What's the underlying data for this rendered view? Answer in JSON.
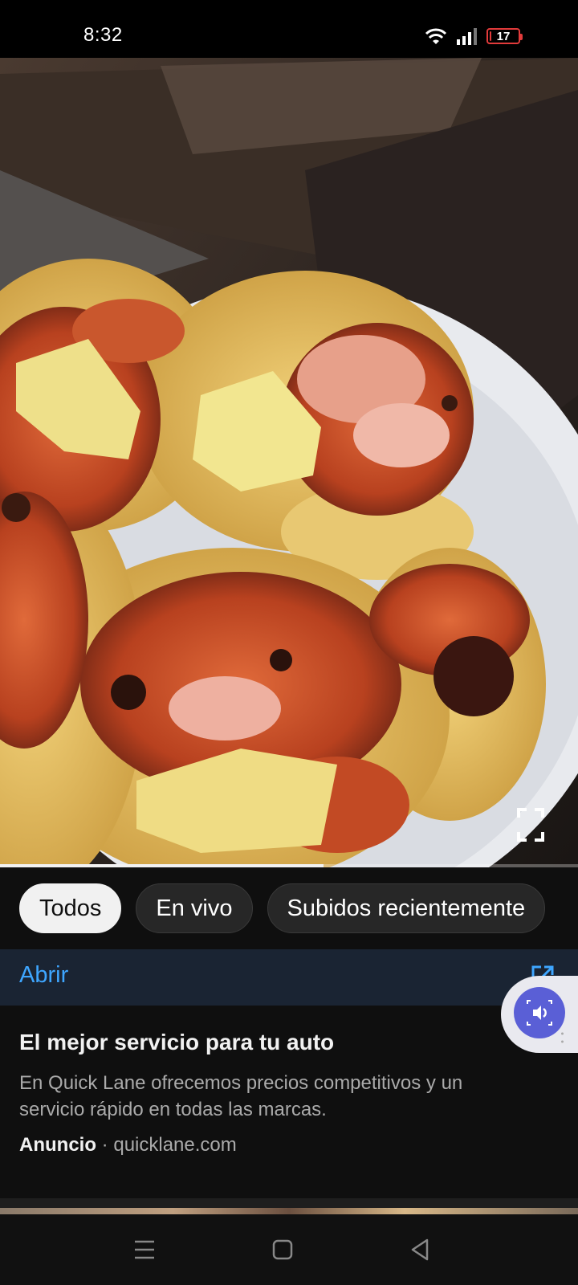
{
  "status_bar": {
    "time": "8:32",
    "battery_level": "17",
    "battery_fraction": 0.17,
    "battery_color": "#e23b3b"
  },
  "video": {
    "progress_fraction": 0.56,
    "icons": {
      "fullscreen": "fullscreen-icon"
    }
  },
  "chips": [
    {
      "label": "Todos",
      "selected": true
    },
    {
      "label": "En vivo",
      "selected": false
    },
    {
      "label": "Subidos recientemente",
      "selected": false
    }
  ],
  "ad": {
    "open_label": "Abrir",
    "open_icon": "external-link-icon",
    "title": "El mejor servicio para tu auto",
    "description": "En Quick Lane ofrecemos precios competitivos y un servicio rápido en todas las marcas.",
    "badge": "Anuncio",
    "separator": "·",
    "domain": "quicklane.com",
    "accent_color": "#3ea6ff"
  },
  "floating_bubble": {
    "icon": "volume-icon",
    "color": "#5a5fd6"
  },
  "nav_bar": {
    "menu_icon": "menu-icon",
    "home_icon": "home-square-icon",
    "back_icon": "back-triangle-icon"
  }
}
